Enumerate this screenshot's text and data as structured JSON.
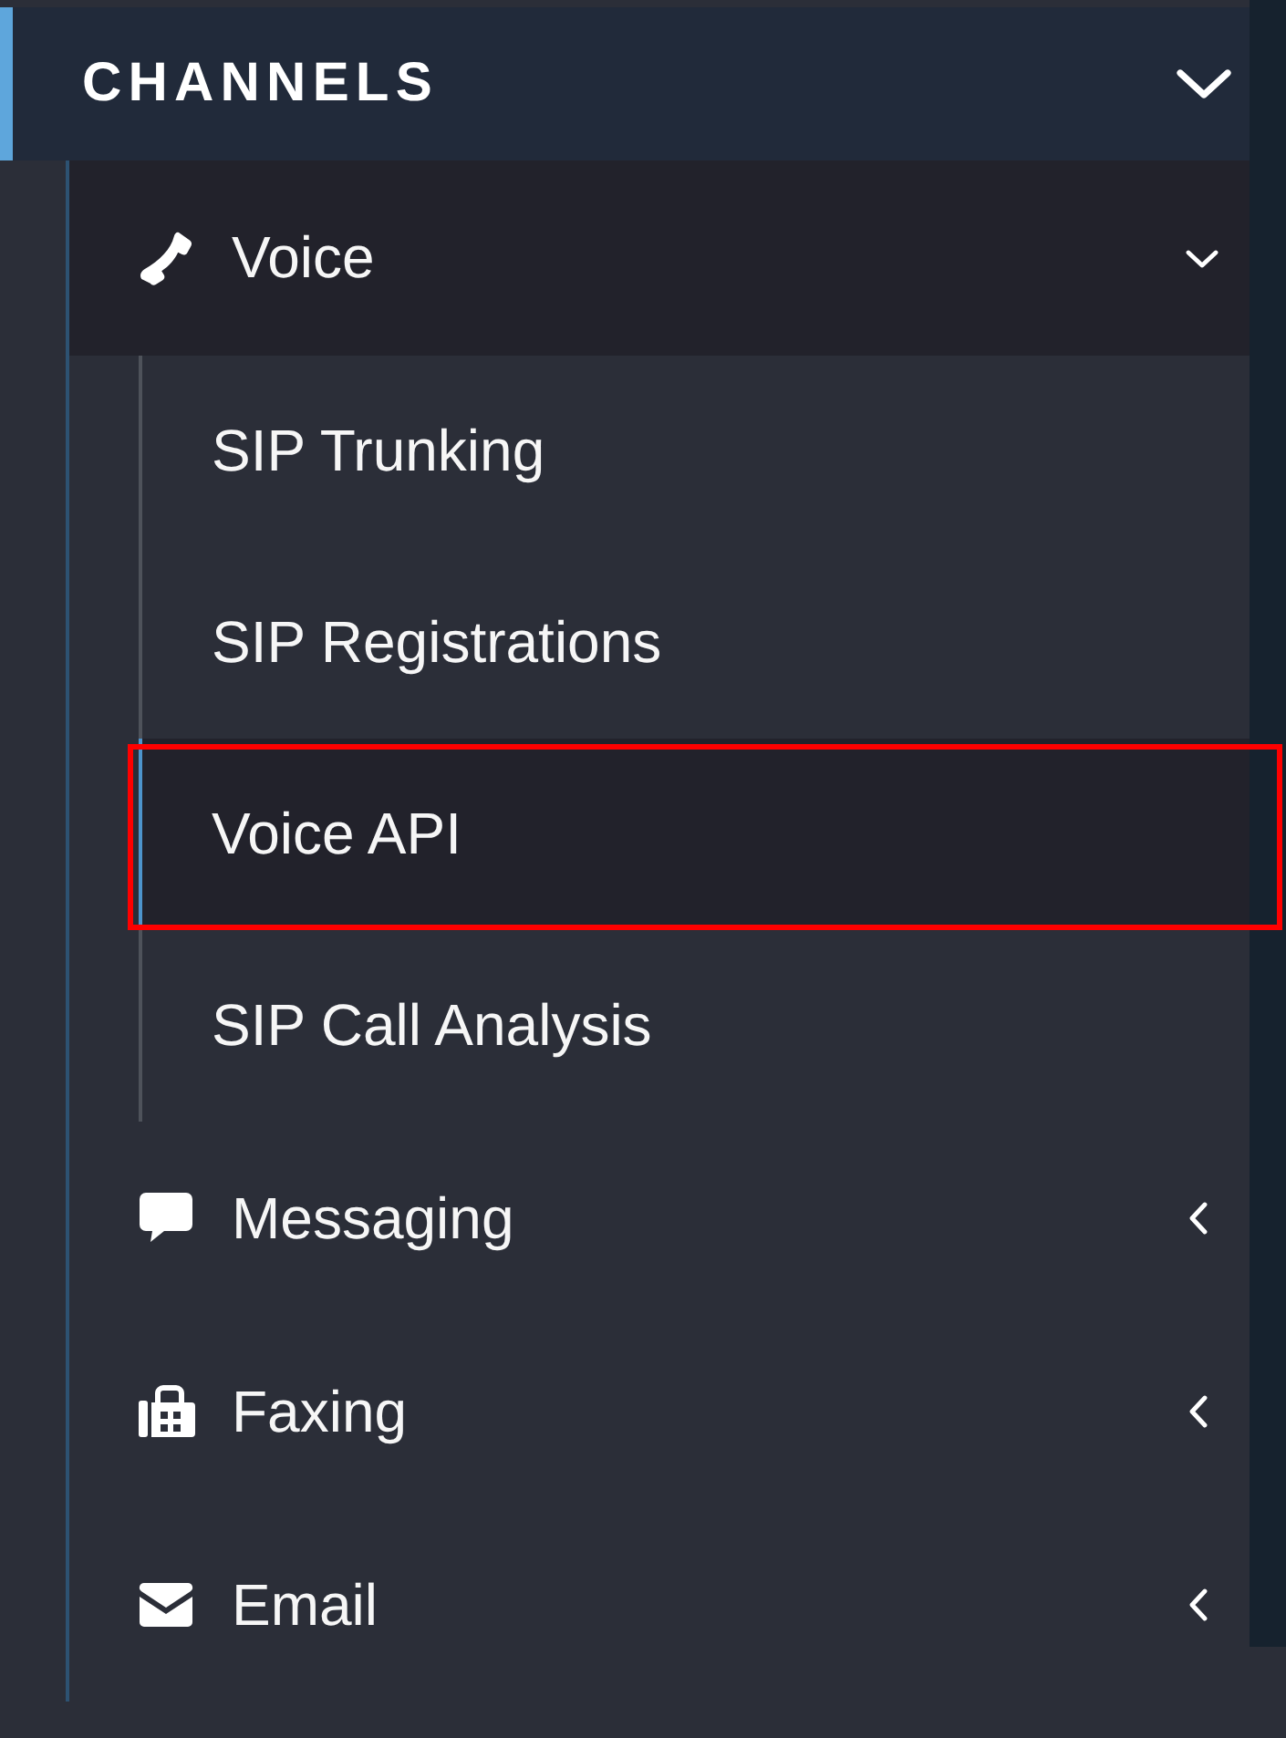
{
  "sidebar": {
    "section": {
      "title": "CHANNELS",
      "expanded": true
    },
    "items": [
      {
        "label": "Voice",
        "expanded": true,
        "children": [
          {
            "label": "SIP Trunking",
            "selected": false,
            "highlighted": false
          },
          {
            "label": "SIP Registrations",
            "selected": false,
            "highlighted": false
          },
          {
            "label": "Voice API",
            "selected": true,
            "highlighted": true
          },
          {
            "label": "SIP Call Analysis",
            "selected": false,
            "highlighted": false
          }
        ]
      },
      {
        "label": "Messaging",
        "expanded": false
      },
      {
        "label": "Faxing",
        "expanded": false
      },
      {
        "label": "Email",
        "expanded": false
      }
    ]
  }
}
